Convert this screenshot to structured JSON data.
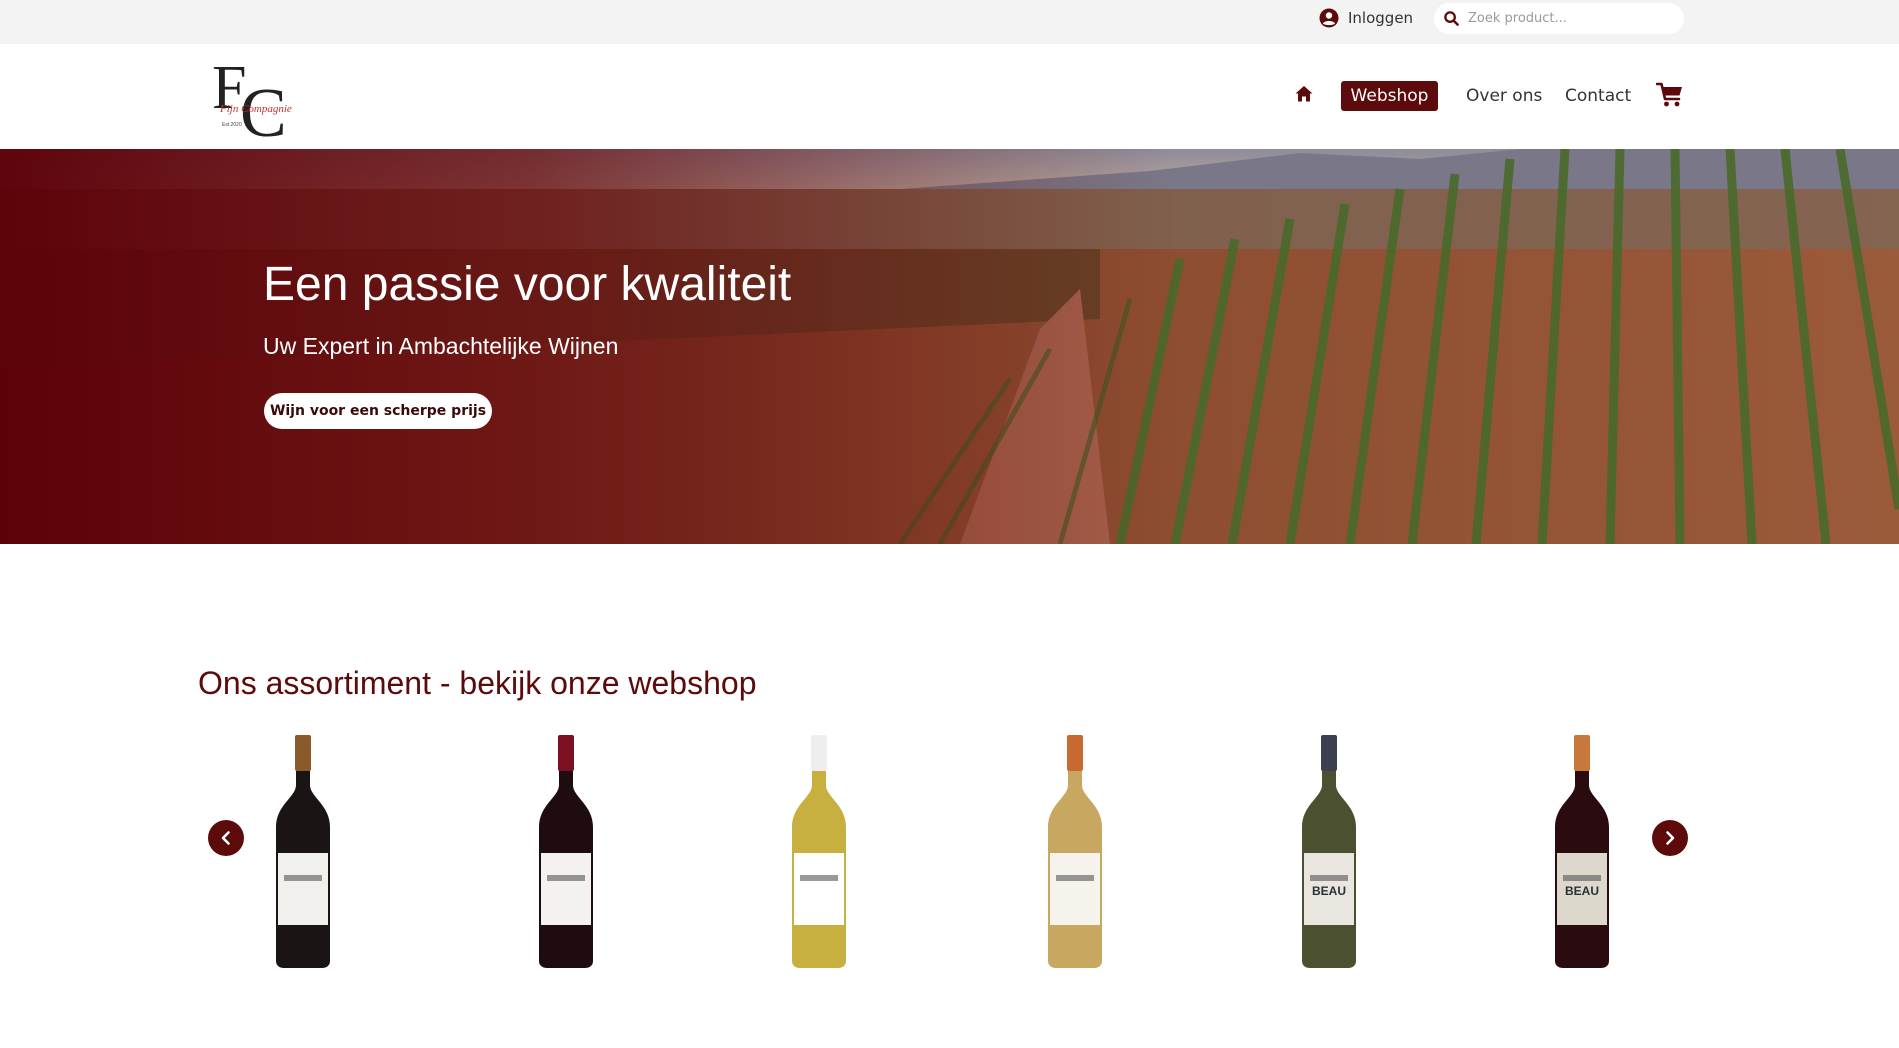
{
  "topbar": {
    "login_label": "Inloggen",
    "search_placeholder": "Zoek product..."
  },
  "brand": {
    "logo_letters": "FC",
    "logo_script": "Fijn Compagnie",
    "logo_est": "Est.2020"
  },
  "nav": {
    "home_icon": "home-icon",
    "items": [
      {
        "label": "Webshop",
        "active": true
      },
      {
        "label": "Over ons",
        "active": false
      },
      {
        "label": "Contact",
        "active": false
      }
    ],
    "cart_icon": "cart-icon"
  },
  "hero": {
    "title": "Een passie voor kwaliteit",
    "subtitle": "Uw Expert in Ambachtelijke Wijnen",
    "cta_label": "Wijn voor een scherpe prijs"
  },
  "assortment": {
    "title": "Ons assortiment - bekijk onze webshop",
    "prev_icon": "chevron-left-icon",
    "next_icon": "chevron-right-icon",
    "products": [
      {
        "name": "red-wine-bottle-1",
        "bottle": "#1a1414",
        "capsule": "#8a5a2a",
        "label": "#f2f0ec",
        "label_text": ""
      },
      {
        "name": "red-wine-bottle-2",
        "bottle": "#1e0c10",
        "capsule": "#7a1020",
        "label": "#f4f2ee",
        "label_text": ""
      },
      {
        "name": "white-wine-bottle-1",
        "bottle": "#c8b040",
        "capsule": "#eeeeee",
        "label": "#ffffff",
        "label_text": ""
      },
      {
        "name": "white-wine-bottle-2",
        "bottle": "#c8a860",
        "capsule": "#c86a30",
        "label": "#f6f2ec",
        "label_text": ""
      },
      {
        "name": "white-wine-bottle-3",
        "bottle": "#4a5030",
        "capsule": "#3a4050",
        "label": "#e8e6df",
        "label_text": "BEAU"
      },
      {
        "name": "red-wine-bottle-3",
        "bottle": "#2a0c10",
        "capsule": "#c8783a",
        "label": "#ddd8cc",
        "label_text": "BEAU"
      }
    ]
  },
  "colors": {
    "brand": "#5c0a0a",
    "topbar_bg": "#f3f3f3"
  }
}
